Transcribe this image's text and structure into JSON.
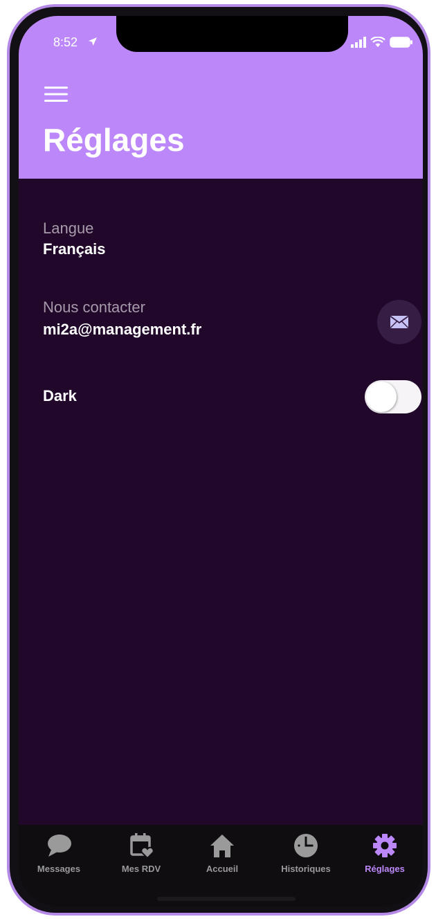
{
  "status_bar": {
    "time": "8:52"
  },
  "header": {
    "title": "Réglages"
  },
  "settings": {
    "language": {
      "label": "Langue",
      "value": "Français"
    },
    "contact": {
      "label": "Nous contacter",
      "value": "mi2a@management.fr"
    },
    "dark": {
      "label": "Dark",
      "enabled": false
    }
  },
  "tabs": [
    {
      "label": "Messages",
      "icon": "chat-bubble-icon"
    },
    {
      "label": "Mes RDV",
      "icon": "calendar-heart-icon"
    },
    {
      "label": "Accueil",
      "icon": "home-icon"
    },
    {
      "label": "Historiques",
      "icon": "clock-icon"
    },
    {
      "label": "Réglages",
      "icon": "gear-icon",
      "active": true
    }
  ],
  "colors": {
    "header_bg": "#bc88f9",
    "screen_bg": "#21082b",
    "accent": "#bc88f9",
    "tab_inactive": "#9a9a9a"
  }
}
